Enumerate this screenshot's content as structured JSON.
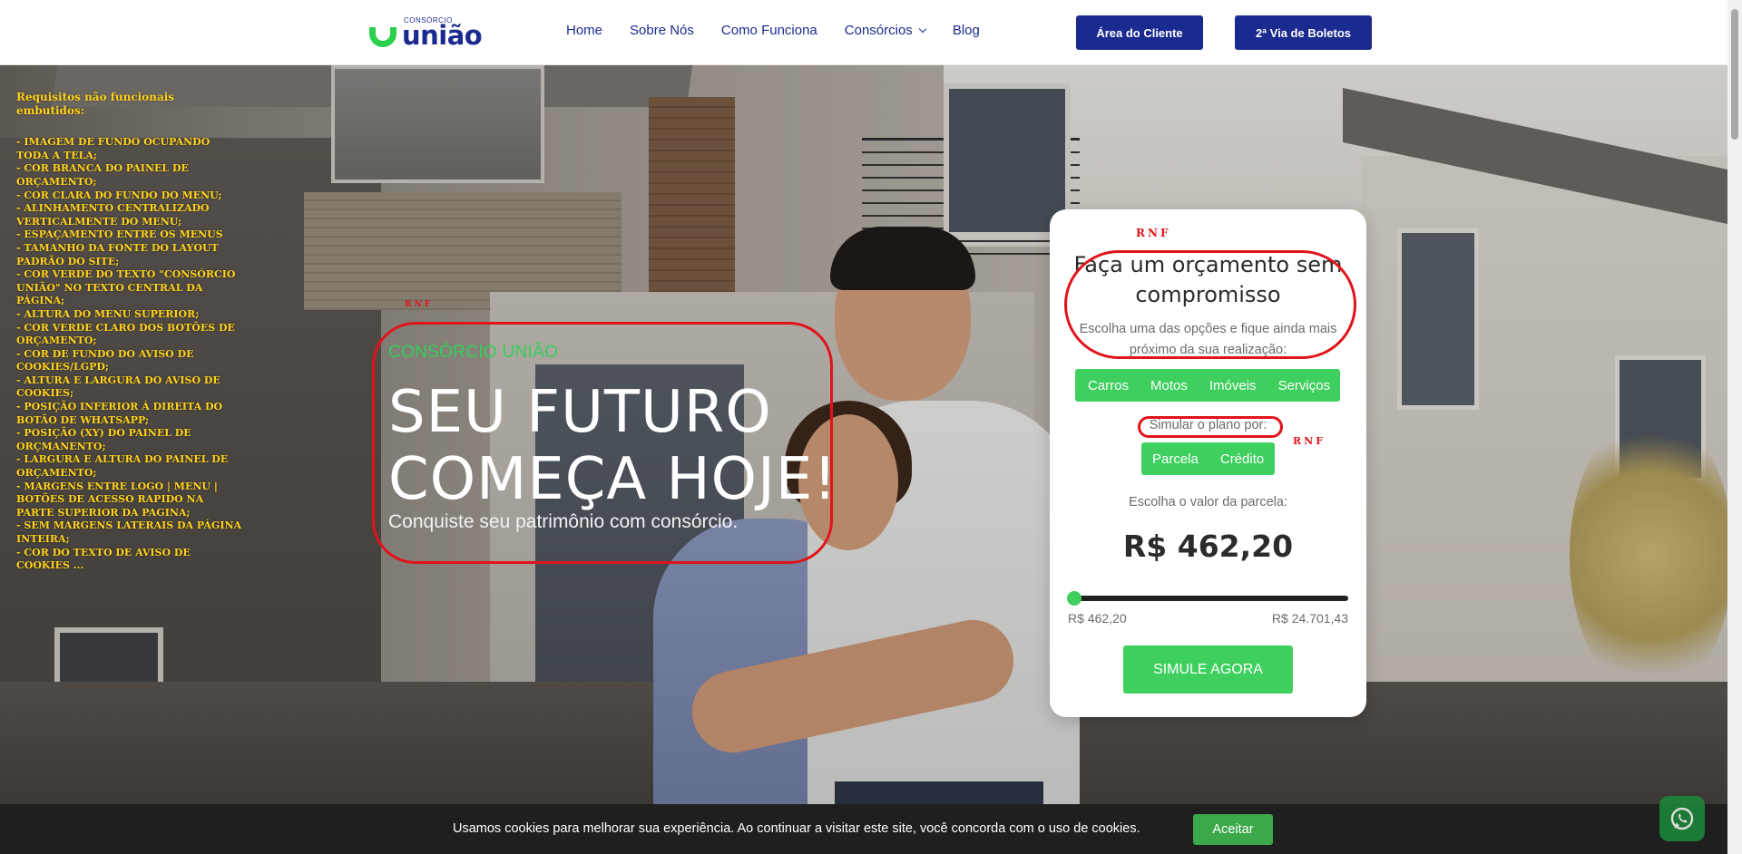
{
  "header": {
    "logo_small": "CONSÓRCIO",
    "logo_big": "união",
    "nav": [
      {
        "label": "Home"
      },
      {
        "label": "Sobre Nós"
      },
      {
        "label": "Como Funciona"
      },
      {
        "label": "Consórcios",
        "has_dropdown": true
      },
      {
        "label": "Blog"
      }
    ],
    "area_cliente": "Área do Cliente",
    "segunda_via": "2ª Via de Boletos"
  },
  "requirements": {
    "title": "Requisitos não funcionais embutidos:",
    "items": [
      "- IMAGEM DE FUNDO OCUPANDO TODA A TELA;",
      "- COR BRANCA DO PAINEL DE ORÇAMENTO;",
      "- COR CLARA DO FUNDO DO MENU;",
      "- ALINHAMENTO CENTRALIZADO VERTICALMENTE DO MENU;",
      "- ESPAÇAMENTO ENTRE OS MENUS",
      "- TAMANHO DA FONTE DO LAYOUT PADRÃO DO SITE;",
      "- COR VERDE DO TEXTO \"CONSÓRCIO UNIÃO\" NO TEXTO CENTRAL DA PÁGINA;",
      "- ALTURA DO MENU SUPERIOR;",
      "- COR VERDE CLARO DOS BOTÕES DE ORÇAMENTO;",
      "- COR DE FUNDO DO AVISO DE COOKIES/LGPD;",
      "- ALTURA E LARGURA DO AVISO DE COOKIES;",
      "- POSIÇÃO INFERIOR Á DIREITA DO BOTÃO DE WHATSAPP;",
      "- POSIÇÃO (XY) DO PAINEL DE ORÇMANENTO;",
      "- LARGURA E ALTURA DO PAINEL DE ORÇAMENTO;",
      "- MARGENS ENTRE LOGO | MENU | BOTÕES DE ACESSO RAPIDO NA PARTE SUPERIOR DA PAGINA;",
      "- SEM MARGENS LATERAIS DA PÁGINA INTEIRA;",
      "- COR DO TEXTO DE AVISO DE COOKIES ..."
    ]
  },
  "hero": {
    "kicker": "CONSÓRCIO UNIÃO",
    "headline_line1": "SEU FUTURO",
    "headline_line2": "COMEÇA HOJE!",
    "subtitle": "Conquiste seu patrimônio com consórcio."
  },
  "annotations": {
    "rnf_label": "RNF"
  },
  "panel": {
    "title": "Faça um orçamento sem compromisso",
    "subtitle": "Escolha uma das opções e fique ainda mais próximo da sua realização:",
    "categories": [
      "Carros",
      "Motos",
      "Imóveis",
      "Serviços"
    ],
    "simulate_by_label": "Simular o plano por:",
    "simulate_by_options": [
      "Parcela",
      "Crédito"
    ],
    "choose_value_label": "Escolha o valor da parcela:",
    "current_value": "R$ 462,20",
    "slider_min": "R$ 462,20",
    "slider_max": "R$ 24.701,43",
    "slider_fraction": 0.01,
    "cta": "SIMULE AGORA"
  },
  "cookie": {
    "message": "Usamos cookies para melhorar sua experiência. Ao continuar a visitar este site, você concorda com o uso de cookies.",
    "accept": "Aceitar"
  },
  "colors": {
    "brand_blue": "#1b2a8f",
    "brand_green": "#3ecf5e",
    "kicker_green": "#30d158",
    "annotation_red": "#e0141b",
    "requirements_yellow": "#ffd21a",
    "cookie_bg": "#1f1f1f"
  },
  "icons": {
    "whatsapp": "whatsapp-icon",
    "dropdown": "chevron-down-icon"
  }
}
